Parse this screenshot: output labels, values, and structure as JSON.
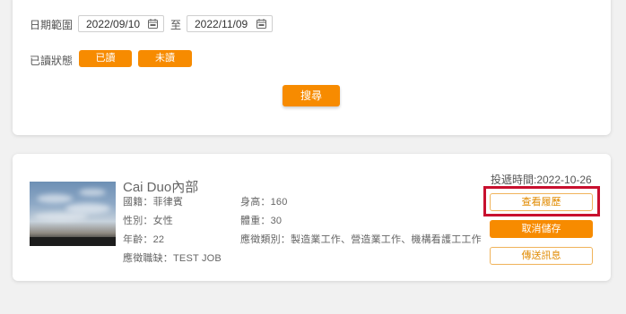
{
  "filters": {
    "date_range_label": "日期範圍",
    "start_date": "2022/09/10",
    "to_label": "至",
    "end_date": "2022/11/09",
    "read_status_label": "已讀狀態",
    "read_button": "已讀",
    "unread_button": "未讀",
    "search_button": "搜尋"
  },
  "result": {
    "name": "Cai Duo內部",
    "nationality": "國籍：菲律賓",
    "gender": "性別：女性",
    "age": "年齡：22",
    "position": "應徵職缺：TEST JOB",
    "height": "身高：160",
    "weight": "體重：30",
    "job_types": "應徵類別：製造業工作、營造業工作、機構看護工工作",
    "sent_time": "投遞時間:2022-10-26",
    "view_resume_button": "查看履歷",
    "cancel_save_button": "取消儲存",
    "send_message_button": "傳送訊息"
  },
  "colors": {
    "accent": "#f78b00",
    "highlight": "#c8102e"
  }
}
